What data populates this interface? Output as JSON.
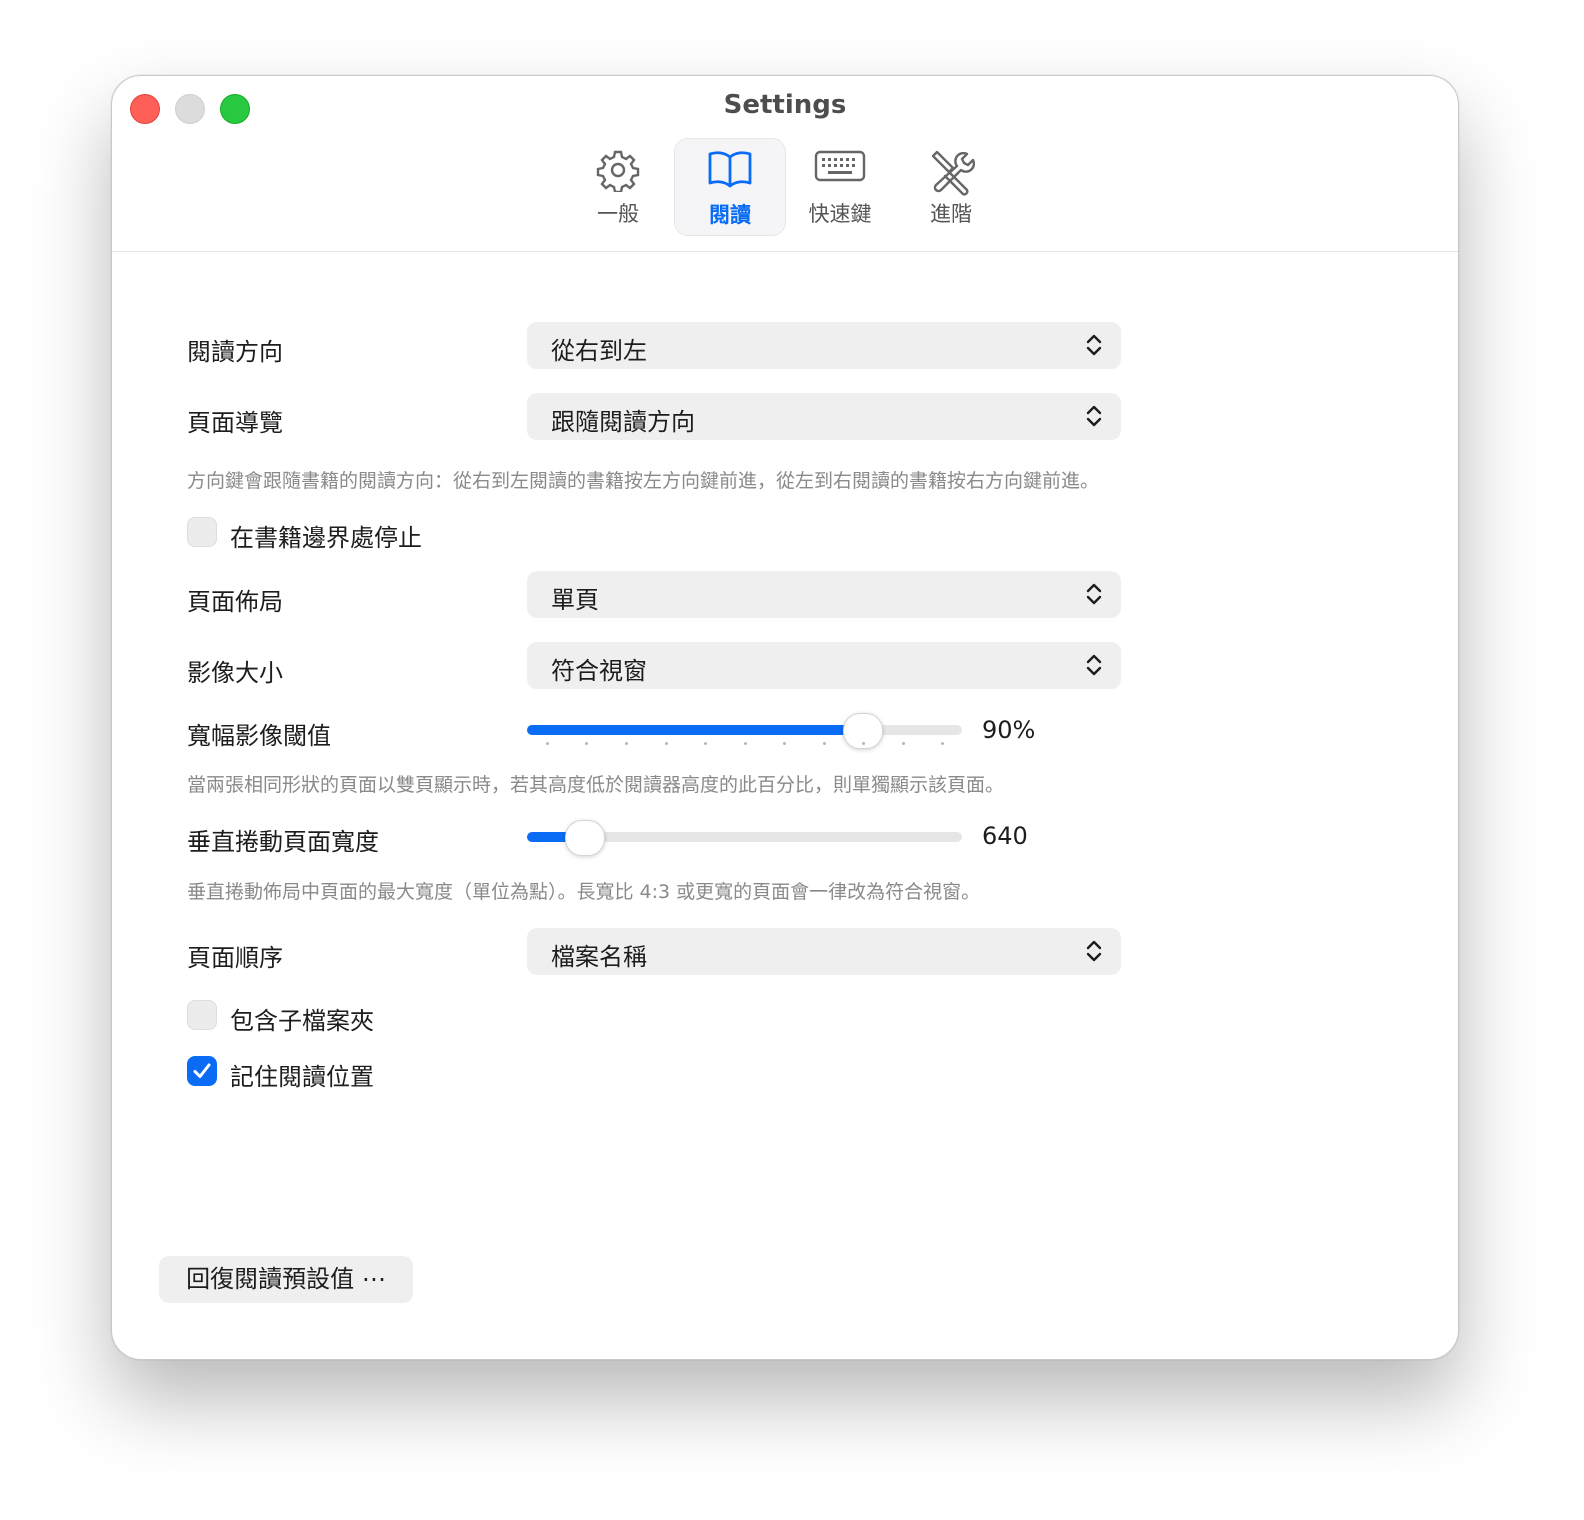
{
  "window": {
    "title": "Settings"
  },
  "tabs": [
    {
      "label": "一般",
      "icon": "gear-icon",
      "active": false
    },
    {
      "label": "閱讀",
      "icon": "book-icon",
      "active": true
    },
    {
      "label": "快速鍵",
      "icon": "keyboard-icon",
      "active": false
    },
    {
      "label": "進階",
      "icon": "tools-icon",
      "active": false
    }
  ],
  "reading": {
    "direction": {
      "label": "閱讀方向",
      "value": "從右到左"
    },
    "page_nav": {
      "label": "頁面導覽",
      "value": "跟隨閱讀方向"
    },
    "page_nav_note": "方向鍵會跟隨書籍的閱讀方向：從右到左閱讀的書籍按左方向鍵前進，從左到右閱讀的書籍按右方向鍵前進。",
    "stop_at_boundary": {
      "label": "在書籍邊界處停止",
      "checked": false
    },
    "page_layout": {
      "label": "頁面佈局",
      "value": "單頁"
    },
    "image_size": {
      "label": "影像大小",
      "value": "符合視窗"
    },
    "wide_threshold": {
      "label": "寬幅影像閾值",
      "value_text": "90%",
      "fraction": 0.77
    },
    "wide_threshold_note": "當兩張相同形狀的頁面以雙頁顯示時，若其高度低於閱讀器高度的此百分比，則單獨顯示該頁面。",
    "vertical_width": {
      "label": "垂直捲動頁面寬度",
      "value_text": "640",
      "fraction": 0.13
    },
    "vertical_width_note": "垂直捲動佈局中頁面的最大寬度（單位為點）。長寬比 4:3 或更寬的頁面會一律改為符合視窗。",
    "page_order": {
      "label": "頁面順序",
      "value": "檔案名稱"
    },
    "include_subfolders": {
      "label": "包含子檔案夾",
      "checked": false
    },
    "remember_position": {
      "label": "記住閱讀位置",
      "checked": true
    },
    "restore_button": "回復閱讀預設值 ⋯"
  },
  "colors": {
    "accent": "#0a6cf5",
    "close": "#fe5f57",
    "zoom": "#28c840"
  }
}
